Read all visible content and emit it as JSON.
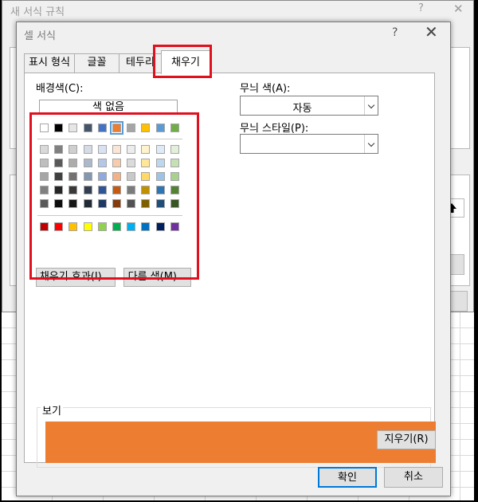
{
  "background_window": {
    "title": "새 서식 규칙",
    "help_glyph": "?",
    "close_glyph": "✕"
  },
  "dialog": {
    "title": "셀 서식",
    "help_glyph": "?",
    "close_glyph": "✕"
  },
  "tabs": [
    {
      "label": "표시 형식",
      "active": false
    },
    {
      "label": "글꼴",
      "active": false
    },
    {
      "label": "테두리",
      "active": false
    },
    {
      "label": "채우기",
      "active": true
    }
  ],
  "fill": {
    "background_color_label": "배경색(C):",
    "no_color_button": "색 없음",
    "selected_color": "#ed7d31",
    "theme_top_row": [
      "#ffffff",
      "#000000",
      "#e7e6e6",
      "#44546a",
      "#4472c4",
      "#ed7d31",
      "#a5a5a5",
      "#ffc000",
      "#5b9bd5",
      "#70ad47"
    ],
    "theme_shades": [
      [
        "#d9d9d9",
        "#808080",
        "#d0cece",
        "#d6dce5",
        "#d9e2f3",
        "#fbe5d6",
        "#ededed",
        "#fff2cc",
        "#deebf7",
        "#e2f0d9"
      ],
      [
        "#bfbfbf",
        "#595959",
        "#aeabab",
        "#adb9ca",
        "#b4c7e7",
        "#f8cbad",
        "#dbdbdb",
        "#ffe699",
        "#bdd7ee",
        "#c5e0b4"
      ],
      [
        "#a6a6a6",
        "#404040",
        "#757171",
        "#8497b0",
        "#8faadc",
        "#f4b183",
        "#c9c9c9",
        "#ffd966",
        "#9dc3e6",
        "#a9d18e"
      ],
      [
        "#808080",
        "#262626",
        "#3b3838",
        "#333f50",
        "#2f5597",
        "#c55a11",
        "#7b7b7b",
        "#bf9000",
        "#2e75b6",
        "#548235"
      ],
      [
        "#595959",
        "#0d0d0d",
        "#171717",
        "#222a35",
        "#1f3864",
        "#843c0c",
        "#525252",
        "#7f6000",
        "#1f4e79",
        "#385723"
      ]
    ],
    "standard_colors": [
      "#c00000",
      "#ff0000",
      "#ffc000",
      "#ffff00",
      "#92d050",
      "#00b050",
      "#00b0f0",
      "#0070c0",
      "#002060",
      "#7030a0"
    ],
    "fill_effects_button": "채우기 효과(I)...",
    "more_colors_button": "다른 색(M)...",
    "pattern_color_label": "무늬 색(A):",
    "pattern_color_value": "자동",
    "pattern_style_label": "무늬 스타일(P):",
    "pattern_style_value": "",
    "preview_label": "보기",
    "clear_button": "지우기(R)"
  },
  "footer": {
    "ok_button": "확인",
    "cancel_button": "취소"
  },
  "colors": {
    "highlight_red": "#e0101e",
    "ok_border": "#0078d7"
  }
}
